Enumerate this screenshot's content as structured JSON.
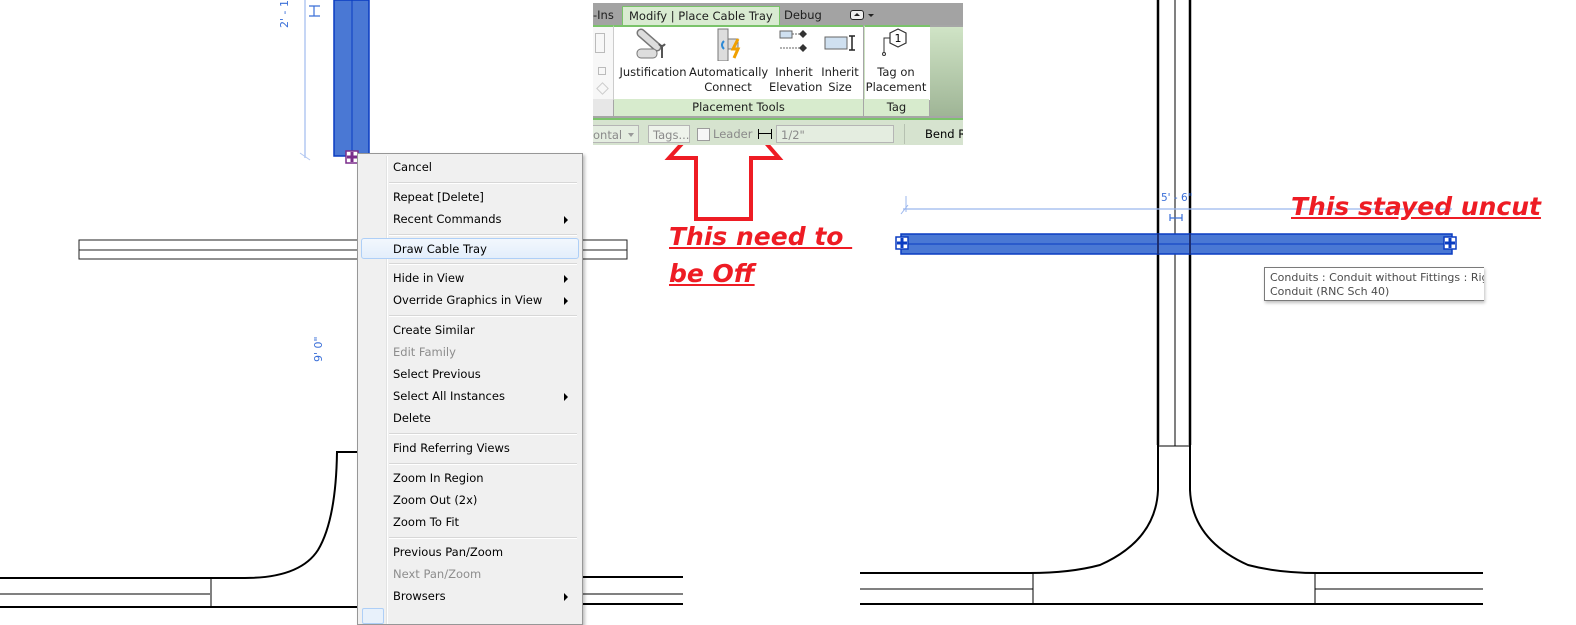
{
  "ribbon": {
    "tabs": [
      {
        "label": "-Ins",
        "active": false
      },
      {
        "label": "Modify | Place Cable Tray",
        "active": true
      },
      {
        "label": "Debug",
        "active": false
      }
    ],
    "panel_toggle_icon": "panel-toggle-icon",
    "buttons": [
      {
        "id": "justification",
        "line1": "Justification",
        "line2": "",
        "icon": "justification-icon"
      },
      {
        "id": "automatically-connect",
        "line1": "Automatically",
        "line2": "Connect",
        "icon": "automatically-connect-icon"
      },
      {
        "id": "inherit-elevation",
        "line1": "Inherit",
        "line2": "Elevation",
        "icon": "inherit-elevation-icon"
      },
      {
        "id": "inherit-size",
        "line1": "Inherit",
        "line2": "Size",
        "icon": "inherit-size-icon"
      },
      {
        "id": "tag-on-placement",
        "line1": "Tag on",
        "line2": "Placement",
        "icon": "tag-icon"
      }
    ],
    "tag_number": "1",
    "panels": [
      {
        "label": "Placement Tools"
      },
      {
        "label": "Tag"
      }
    ],
    "options_bar": {
      "orientation_value": "ontal",
      "tags_button": "Tags...",
      "leader_label": "Leader",
      "leader_checked": false,
      "length_value": "1/2\"",
      "bend_label": "Bend R"
    }
  },
  "context_menu": {
    "items": [
      {
        "label": "Cancel",
        "enabled": true,
        "submenu": false
      },
      {
        "label": "Repeat [Delete]",
        "enabled": true,
        "submenu": false
      },
      {
        "label": "Recent Commands",
        "enabled": true,
        "submenu": true
      },
      {
        "label": "Draw Cable Tray",
        "enabled": true,
        "submenu": false,
        "highlighted": true
      },
      {
        "label": "Hide in View",
        "enabled": true,
        "submenu": true
      },
      {
        "label": "Override Graphics in View",
        "enabled": true,
        "submenu": true
      },
      {
        "label": "Create Similar",
        "enabled": true,
        "submenu": false
      },
      {
        "label": "Edit Family",
        "enabled": false,
        "submenu": false
      },
      {
        "label": "Select Previous",
        "enabled": true,
        "submenu": false
      },
      {
        "label": "Select All Instances",
        "enabled": true,
        "submenu": true
      },
      {
        "label": "Delete",
        "enabled": true,
        "submenu": false
      },
      {
        "label": "Find Referring Views",
        "enabled": true,
        "submenu": false
      },
      {
        "label": "Zoom In Region",
        "enabled": true,
        "submenu": false
      },
      {
        "label": "Zoom Out (2x)",
        "enabled": true,
        "submenu": false
      },
      {
        "label": "Zoom To Fit",
        "enabled": true,
        "submenu": false
      },
      {
        "label": "Previous Pan/Zoom",
        "enabled": true,
        "submenu": false
      },
      {
        "label": "Next Pan/Zoom",
        "enabled": false,
        "submenu": false
      },
      {
        "label": "Browsers",
        "enabled": true,
        "submenu": true
      }
    ]
  },
  "left_view": {
    "dimension_top": "2' - 1",
    "dimension_mid": "9' 0\""
  },
  "right_view": {
    "dimension_label": "5' - 6\"",
    "tooltip_line1": "Conduits : Conduit without Fittings : Rigid Nonmetallic",
    "tooltip_line2": "Conduit (RNC Sch 40)"
  },
  "annotations": {
    "arrow_note_line1": "This need to ",
    "arrow_note_line2": "be Off",
    "uncut_note": "This stayed uncut",
    "color": "#ee1c24"
  },
  "colors": {
    "selection_blue": "#4a78d4",
    "selection_edge": "#0a3cc2",
    "dimension_blue": "#3a6fd8",
    "ribbon_green": "#7ac36a"
  }
}
